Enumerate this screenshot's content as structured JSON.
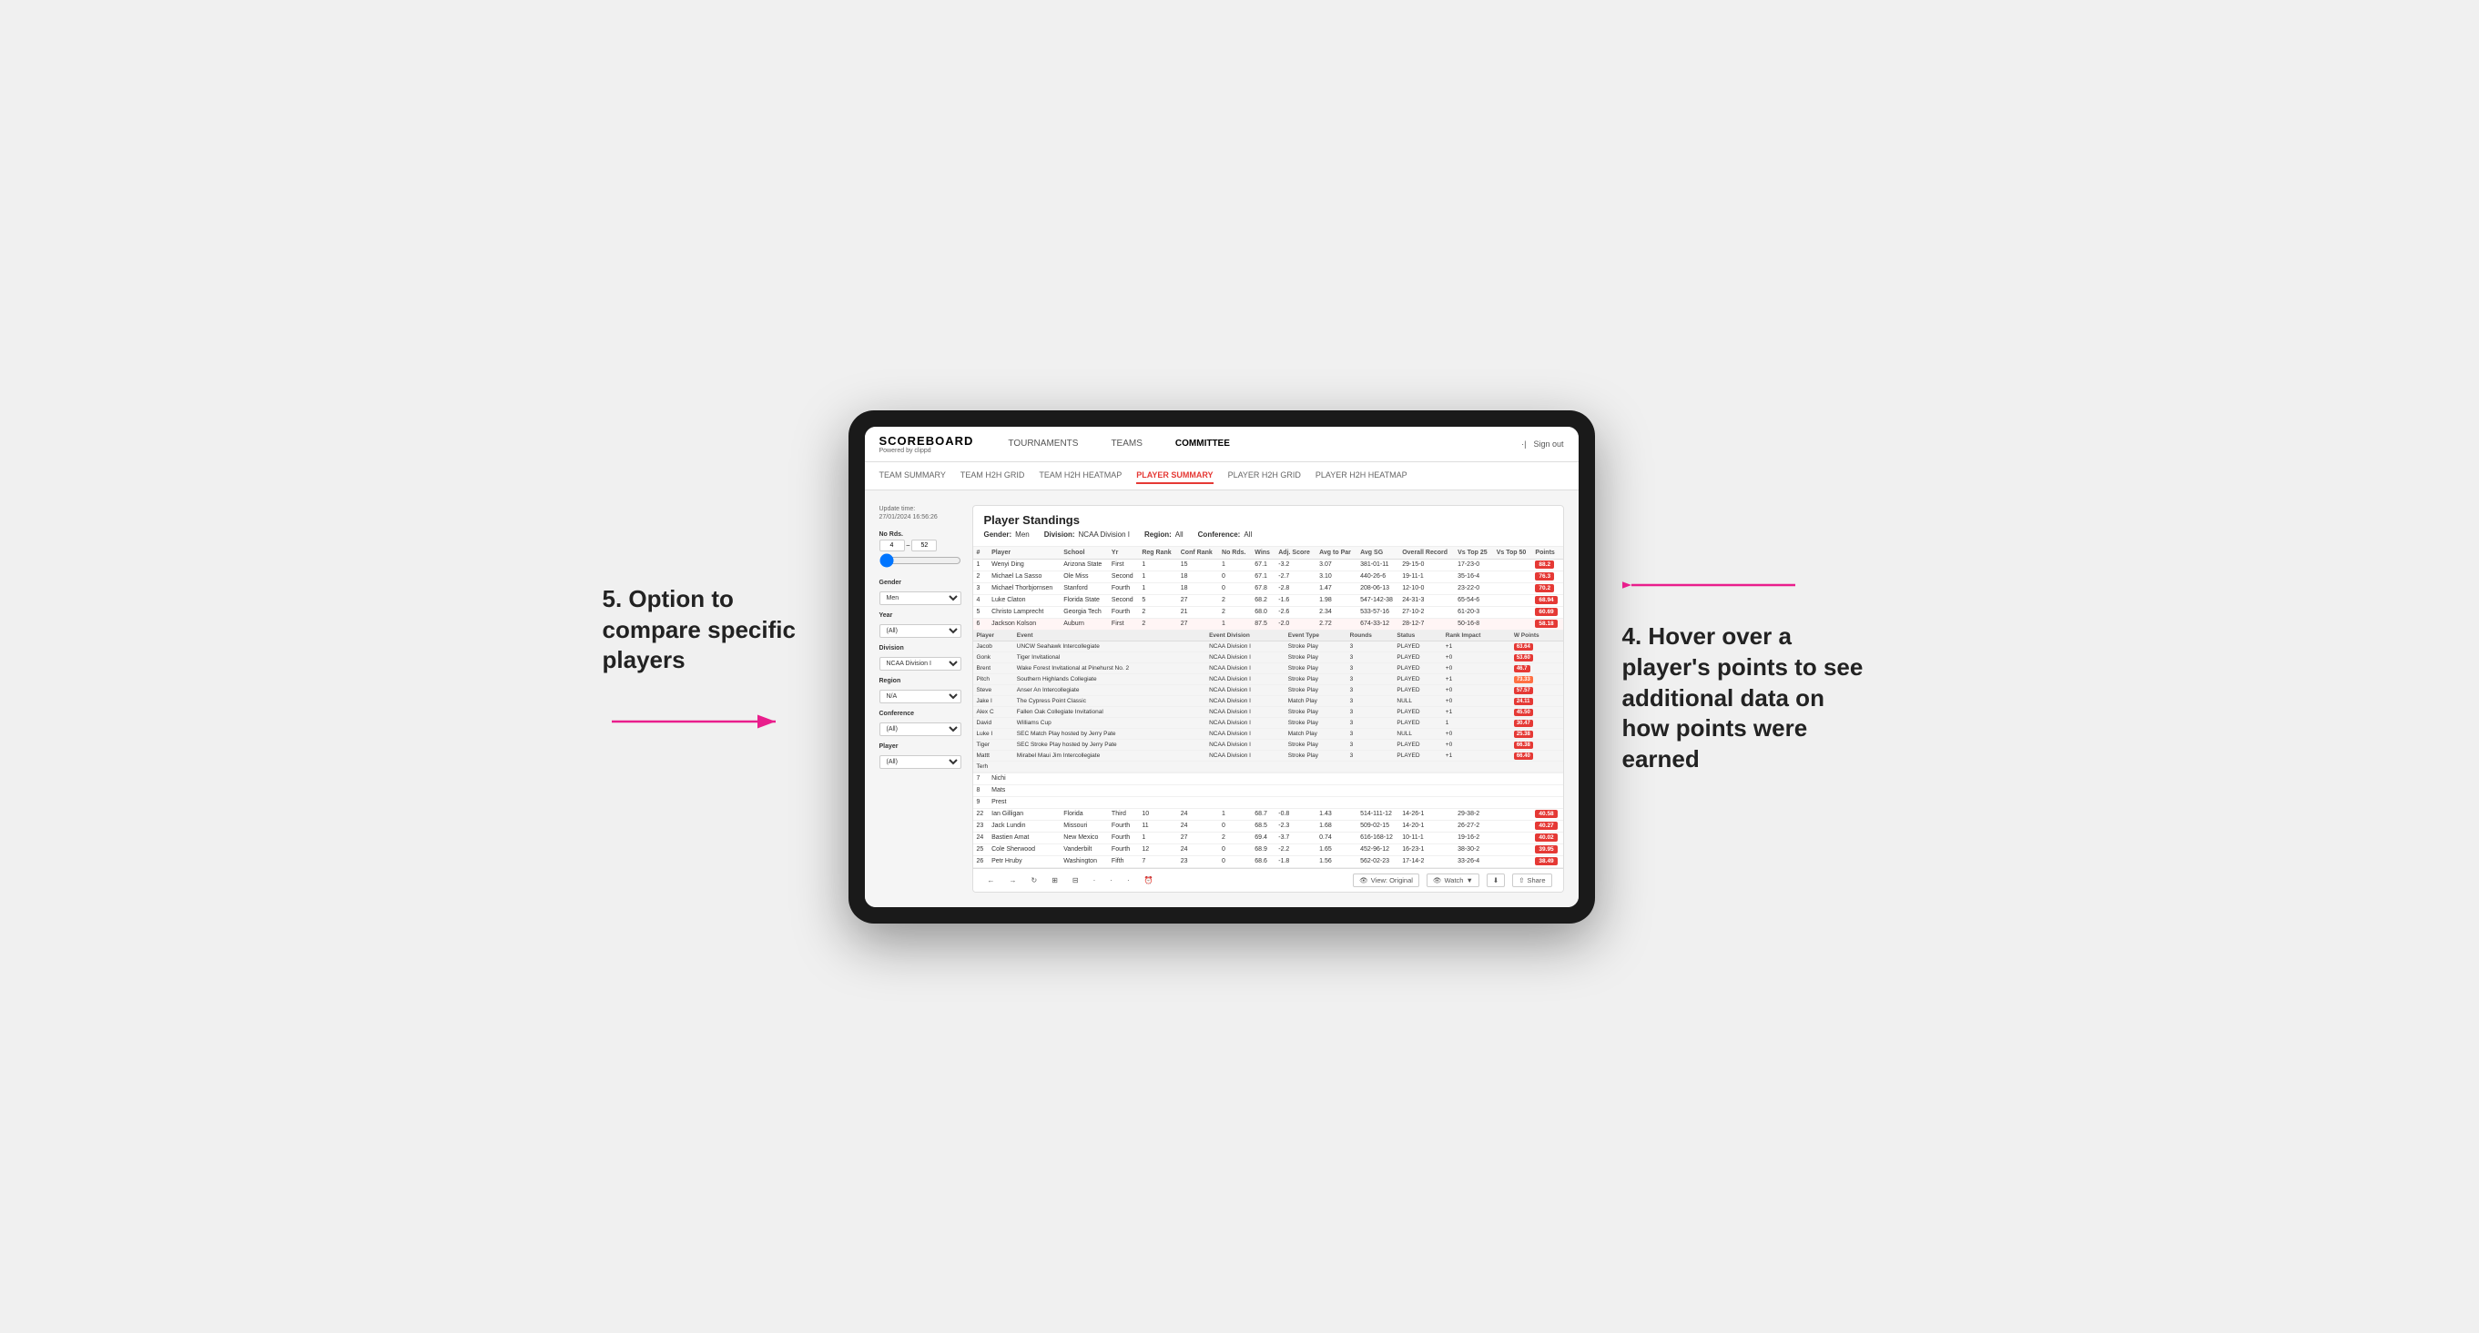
{
  "page": {
    "background": "#f0f0f0"
  },
  "annotations": {
    "top_right": {
      "number": "4.",
      "text": "Hover over a player's points to see additional data on how points were earned"
    },
    "bottom_left": {
      "number": "5.",
      "text": "Option to compare specific players"
    }
  },
  "top_nav": {
    "logo": "SCOREBOARD",
    "logo_sub": "Powered by clippd",
    "items": [
      "TOURNAMENTS",
      "TEAMS",
      "COMMITTEE"
    ],
    "right_items": [
      "Sign out"
    ]
  },
  "sub_nav": {
    "items": [
      {
        "label": "TEAM SUMMARY",
        "active": false
      },
      {
        "label": "TEAM H2H GRID",
        "active": false
      },
      {
        "label": "TEAM H2H HEATMAP",
        "active": false
      },
      {
        "label": "PLAYER SUMMARY",
        "active": true
      },
      {
        "label": "PLAYER H2H GRID",
        "active": false
      },
      {
        "label": "PLAYER H2H HEATMAP",
        "active": false
      }
    ]
  },
  "sidebar": {
    "update_time_label": "Update time:",
    "update_time_value": "27/01/2024 16:56:26",
    "no_rds_label": "No Rds.",
    "no_rds_min": "4",
    "no_rds_max": "52",
    "filters": [
      {
        "label": "Gender",
        "value": "Men"
      },
      {
        "label": "Year",
        "value": "(All)"
      },
      {
        "label": "Division",
        "value": "NCAA Division I"
      },
      {
        "label": "Region",
        "value": "N/A"
      },
      {
        "label": "Conference",
        "value": "(All)"
      },
      {
        "label": "Player",
        "value": "(All)"
      }
    ]
  },
  "panel": {
    "title": "Player Standings",
    "filters": [
      {
        "label": "Gender:",
        "value": "Men"
      },
      {
        "label": "Division:",
        "value": "NCAA Division I"
      },
      {
        "label": "Region:",
        "value": "All"
      },
      {
        "label": "Conference:",
        "value": "All"
      }
    ],
    "table_headers": [
      "#",
      "Player",
      "School",
      "Yr",
      "Reg Rank",
      "Conf Rank",
      "No Rds.",
      "Wins",
      "Adj. Score",
      "Avg to Par",
      "Avg SG",
      "Overall Record",
      "Vs Top 25",
      "Vs Top 50",
      "Points"
    ],
    "rows": [
      {
        "num": "1",
        "player": "Wenyi Ding",
        "school": "Arizona State",
        "yr": "First",
        "reg_rank": "1",
        "conf_rank": "15",
        "no_rds": "1",
        "wins": "67.1",
        "adj_score": "-3.2",
        "avg_to_par": "3.07",
        "avg_sg": "381-01-11",
        "overall": "29-15-0",
        "vs_top25": "17-23-0",
        "vs_top50": "",
        "points": "88.2",
        "highlight": true
      },
      {
        "num": "2",
        "player": "Michael La Sasso",
        "school": "Ole Miss",
        "yr": "Second",
        "reg_rank": "1",
        "conf_rank": "18",
        "no_rds": "0",
        "wins": "67.1",
        "adj_score": "-2.7",
        "avg_to_par": "3.10",
        "avg_sg": "440-26-6",
        "overall": "19-11-1",
        "vs_top25": "35-16-4",
        "vs_top50": "",
        "points": "76.3"
      },
      {
        "num": "3",
        "player": "Michael Thorbjornsen",
        "school": "Stanford",
        "yr": "Fourth",
        "reg_rank": "1",
        "conf_rank": "18",
        "no_rds": "0",
        "wins": "67.8",
        "adj_score": "-2.8",
        "avg_to_par": "1.47",
        "avg_sg": "208-06-13",
        "overall": "12-10-0",
        "vs_top25": "23-22-0",
        "vs_top50": "",
        "points": "70.2"
      },
      {
        "num": "4",
        "player": "Luke Claton",
        "school": "Florida State",
        "yr": "Second",
        "reg_rank": "5",
        "conf_rank": "27",
        "no_rds": "2",
        "wins": "68.2",
        "adj_score": "-1.6",
        "avg_to_par": "1.98",
        "avg_sg": "547-142-38",
        "overall": "24-31-3",
        "vs_top25": "65-54-6",
        "vs_top50": "",
        "points": "68.94"
      },
      {
        "num": "5",
        "player": "Christo Lamprecht",
        "school": "Georgia Tech",
        "yr": "Fourth",
        "reg_rank": "2",
        "conf_rank": "21",
        "no_rds": "2",
        "wins": "68.0",
        "adj_score": "-2.6",
        "avg_to_par": "2.34",
        "avg_sg": "533-57-16",
        "overall": "27-10-2",
        "vs_top25": "61-20-3",
        "vs_top50": "",
        "points": "60.69"
      },
      {
        "num": "6",
        "player": "Jackson Kolson",
        "school": "Auburn",
        "yr": "First",
        "reg_rank": "2",
        "conf_rank": "27",
        "no_rds": "1",
        "wins": "87.5",
        "adj_score": "-2.0",
        "avg_to_par": "2.72",
        "avg_sg": "674-33-12",
        "overall": "28-12-7",
        "vs_top25": "50-16-8",
        "vs_top50": "",
        "points": "58.18"
      },
      {
        "num": "7",
        "player": "Nichi",
        "school": "",
        "yr": "",
        "reg_rank": "",
        "conf_rank": "",
        "no_rds": "",
        "wins": "",
        "adj_score": "",
        "avg_to_par": "",
        "avg_sg": "",
        "overall": "",
        "vs_top25": "",
        "vs_top50": "",
        "points": ""
      },
      {
        "num": "8",
        "player": "Mats",
        "school": "",
        "yr": "",
        "reg_rank": "",
        "conf_rank": "",
        "no_rds": "",
        "wins": "",
        "adj_score": "",
        "avg_to_par": "",
        "avg_sg": "",
        "overall": "",
        "vs_top25": "",
        "vs_top50": "",
        "points": ""
      },
      {
        "num": "9",
        "player": "Prest",
        "school": "",
        "yr": "",
        "reg_rank": "",
        "conf_rank": "",
        "no_rds": "",
        "wins": "",
        "adj_score": "",
        "avg_to_par": "",
        "avg_sg": "",
        "overall": "",
        "vs_top25": "",
        "vs_top50": "",
        "points": ""
      }
    ],
    "expanded_player": "Jackson Kolson",
    "expanded_headers": [
      "Player",
      "Event",
      "Event Division",
      "Event Type",
      "Rounds",
      "Status",
      "Rank Impact",
      "W Points"
    ],
    "expanded_rows": [
      {
        "player": "Jacob",
        "event": "UNCW Seahawk Intercollegiate",
        "division": "NCAA Division I",
        "type": "Stroke Play",
        "rounds": "3",
        "status": "PLAYED",
        "rank_impact": "+1",
        "w_points": "63.64",
        "highlight": true
      },
      {
        "player": "Gonk",
        "event": "Tiger Invitational",
        "division": "NCAA Division I",
        "type": "Stroke Play",
        "rounds": "3",
        "status": "PLAYED",
        "rank_impact": "+0",
        "w_points": "53.60"
      },
      {
        "player": "Brent",
        "event": "Wake Forest Invitational at Pinehurst No. 2",
        "division": "NCAA Division I",
        "type": "Stroke Play",
        "rounds": "3",
        "status": "PLAYED",
        "rank_impact": "+0",
        "w_points": "46.7"
      },
      {
        "player": "Pitch",
        "event": "Southern Highlands Collegiate",
        "division": "NCAA Division I",
        "type": "Stroke Play",
        "rounds": "3",
        "status": "PLAYED",
        "rank_impact": "+1",
        "w_points": "73.33",
        "highlight": true
      },
      {
        "player": "Steve",
        "event": "Anser An Intercollegiate",
        "division": "NCAA Division I",
        "type": "Stroke Play",
        "rounds": "3",
        "status": "PLAYED",
        "rank_impact": "+0",
        "w_points": "57.57"
      },
      {
        "player": "Jake I",
        "event": "The Cypress Point Classic",
        "division": "NCAA Division I",
        "type": "Match Play",
        "rounds": "3",
        "status": "NULL",
        "rank_impact": "+0",
        "w_points": "24.11"
      },
      {
        "player": "Alex C",
        "event": "Fallen Oak Collegiate Invitational",
        "division": "NCAA Division I",
        "type": "Stroke Play",
        "rounds": "3",
        "status": "PLAYED",
        "rank_impact": "+1",
        "w_points": "45.50"
      },
      {
        "player": "David",
        "event": "Williams Cup",
        "division": "NCAA Division I",
        "type": "Stroke Play",
        "rounds": "3",
        "status": "PLAYED",
        "rank_impact": "1",
        "w_points": "30.47"
      },
      {
        "player": "Luke I",
        "event": "SEC Match Play hosted by Jerry Pate",
        "division": "NCAA Division I",
        "type": "Match Play",
        "rounds": "3",
        "status": "NULL",
        "rank_impact": "+0",
        "w_points": "25.38"
      },
      {
        "player": "Tiger",
        "event": "SEC Stroke Play hosted by Jerry Pate",
        "division": "NCAA Division I",
        "type": "Stroke Play",
        "rounds": "3",
        "status": "PLAYED",
        "rank_impact": "+0",
        "w_points": "66.38"
      },
      {
        "player": "Mattt",
        "event": "Mirabel Maui Jim Intercollegiate",
        "division": "NCAA Division I",
        "type": "Stroke Play",
        "rounds": "3",
        "status": "PLAYED",
        "rank_impact": "+1",
        "w_points": "66.40"
      },
      {
        "player": "Terh",
        "event": "",
        "division": "",
        "type": "",
        "rounds": "",
        "status": "",
        "rank_impact": "",
        "w_points": ""
      }
    ],
    "lower_rows": [
      {
        "num": "22",
        "player": "Ian Gilligan",
        "school": "Florida",
        "yr": "Third",
        "reg_rank": "10",
        "conf_rank": "24",
        "no_rds": "1",
        "wins": "68.7",
        "adj_score": "-0.8",
        "avg_to_par": "1.43",
        "avg_sg": "514-111-12",
        "overall": "14-26-1",
        "vs_top25": "29-38-2",
        "vs_top50": "",
        "points": "40.58"
      },
      {
        "num": "23",
        "player": "Jack Lundin",
        "school": "Missouri",
        "yr": "Fourth",
        "reg_rank": "11",
        "conf_rank": "24",
        "no_rds": "0",
        "wins": "68.5",
        "adj_score": "-2.3",
        "avg_to_par": "1.68",
        "avg_sg": "509-02-15",
        "overall": "14-20-1",
        "vs_top25": "26-27-2",
        "vs_top50": "",
        "points": "40.27"
      },
      {
        "num": "24",
        "player": "Bastien Amat",
        "school": "New Mexico",
        "yr": "Fourth",
        "reg_rank": "1",
        "conf_rank": "27",
        "no_rds": "2",
        "wins": "69.4",
        "adj_score": "-3.7",
        "avg_to_par": "0.74",
        "avg_sg": "616-168-12",
        "overall": "10-11-1",
        "vs_top25": "19-16-2",
        "vs_top50": "",
        "points": "40.02"
      },
      {
        "num": "25",
        "player": "Cole Sherwood",
        "school": "Vanderbilt",
        "yr": "Fourth",
        "reg_rank": "12",
        "conf_rank": "24",
        "no_rds": "0",
        "wins": "68.9",
        "adj_score": "-2.2",
        "avg_to_par": "1.65",
        "avg_sg": "452-96-12",
        "overall": "16-23-1",
        "vs_top25": "38-30-2",
        "vs_top50": "",
        "points": "39.95"
      },
      {
        "num": "26",
        "player": "Petr Hruby",
        "school": "Washington",
        "yr": "Fifth",
        "reg_rank": "7",
        "conf_rank": "23",
        "no_rds": "0",
        "wins": "68.6",
        "adj_score": "-1.8",
        "avg_to_par": "1.56",
        "avg_sg": "562-02-23",
        "overall": "17-14-2",
        "vs_top25": "33-26-4",
        "vs_top50": "",
        "points": "38.49"
      }
    ]
  },
  "toolbar": {
    "buttons": [
      "←",
      "→",
      "↺",
      "⊞",
      "⊟",
      "·",
      "·",
      "·",
      "⏱"
    ],
    "view_label": "View: Original",
    "watch_label": "Watch",
    "share_label": "Share"
  }
}
